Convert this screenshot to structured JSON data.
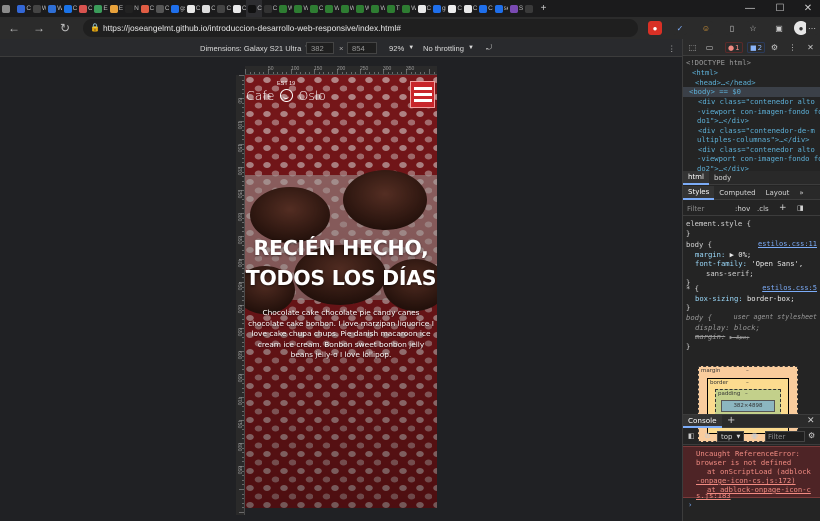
{
  "browser": {
    "tabs": [
      {
        "icon": "sidebar-icon",
        "label": "",
        "color": "#8a8a8a"
      },
      {
        "icon": "tab-favicon",
        "label": "Ca",
        "color": "#3367d6"
      },
      {
        "icon": "tab-favicon",
        "label": "W",
        "color": "#444"
      },
      {
        "icon": "tab-favicon",
        "label": "W",
        "color": "#2f6fd6"
      },
      {
        "icon": "tab-favicon",
        "label": "Ca",
        "color": "#1a73e8"
      },
      {
        "icon": "tab-favicon",
        "label": "Cs",
        "color": "#d9534f"
      },
      {
        "icon": "tab-favicon",
        "label": "Es",
        "color": "#3b9c5a"
      },
      {
        "icon": "tab-favicon",
        "label": "Es",
        "color": "#e9a23b"
      },
      {
        "icon": "tab-favicon",
        "label": "N",
        "color": "#222"
      },
      {
        "icon": "tab-favicon",
        "label": "Ce",
        "color": "#e05d44"
      },
      {
        "icon": "tab-favicon",
        "label": "Cs",
        "color": "#555"
      },
      {
        "icon": "tab-favicon",
        "label": "gs",
        "color": "#1f6feb"
      },
      {
        "icon": "tab-favicon",
        "label": "Ci",
        "color": "#e9e9e9"
      },
      {
        "icon": "tab-favicon",
        "label": "Ce",
        "color": "#ddd"
      },
      {
        "icon": "tab-favicon",
        "label": "Cs",
        "color": "#444"
      },
      {
        "icon": "tab-favicon",
        "label": "Cs",
        "color": "#e9e9e9"
      },
      {
        "icon": "tab-favicon",
        "label": "CS",
        "color": "#111"
      },
      {
        "icon": "tab-favicon",
        "label": "Cs",
        "color": "#333"
      },
      {
        "icon": "tab-favicon",
        "label": "W",
        "color": "#2e7d32"
      },
      {
        "icon": "tab-favicon",
        "label": "W",
        "color": "#2e7d32"
      },
      {
        "icon": "tab-favicon",
        "label": "Ce",
        "color": "#2e7d32"
      },
      {
        "icon": "tab-favicon",
        "label": "W",
        "color": "#2e7d32"
      },
      {
        "icon": "tab-favicon",
        "label": "W",
        "color": "#2e7d32"
      },
      {
        "icon": "tab-favicon",
        "label": "W",
        "color": "#2e7d32"
      },
      {
        "icon": "tab-favicon",
        "label": "W",
        "color": "#2e7d32"
      },
      {
        "icon": "tab-favicon",
        "label": "Tr",
        "color": "#2e7d32"
      },
      {
        "icon": "tab-favicon",
        "label": "W",
        "color": "#2e7d32"
      },
      {
        "icon": "tab-favicon",
        "label": "Cs",
        "color": "#e9e9e9"
      },
      {
        "icon": "tab-favicon",
        "label": "gi",
        "color": "#1f6feb"
      },
      {
        "icon": "tab-favicon",
        "label": "Cr",
        "color": "#eee"
      },
      {
        "icon": "tab-favicon",
        "label": "Ce",
        "color": "#e9e9e9"
      },
      {
        "icon": "tab-favicon",
        "label": "Ce",
        "color": "#1f6feb"
      },
      {
        "icon": "tab-favicon",
        "label": "se",
        "color": "#1f6feb"
      },
      {
        "icon": "tab-favicon",
        "label": "Sc",
        "color": "#7a4ab3"
      },
      {
        "icon": "tab-favicon",
        "label": "",
        "color": "#3a3a3a"
      }
    ],
    "new_tab": "+",
    "window_controls": {
      "minimize": "—",
      "maximize": "☐",
      "close": "✕"
    },
    "url": "https://joseangelmt.github.io/introduccion-desarrollo-web-responsive/index.html#"
  },
  "device_toolbar": {
    "dimensions_label": "Dimensions: Galaxy S21 Ultra",
    "width": "382",
    "times": "×",
    "height": "854",
    "zoom": "92%",
    "throttling": "No throttling"
  },
  "ruler": {
    "top_marks": [
      "50",
      "100",
      "150",
      "200",
      "250",
      "300",
      "350"
    ],
    "left_marks": [
      "50",
      "100",
      "150",
      "200",
      "250",
      "300",
      "350",
      "400",
      "450",
      "500",
      "550",
      "600",
      "650",
      "700",
      "750",
      "800",
      "850"
    ]
  },
  "page": {
    "logo_left": "Cafe",
    "logo_right": "Oslo",
    "logo_est": "EST 19",
    "hero_title_line1": "RECIÉN HECHO,",
    "hero_title_line2": "TODOS LOS DÍAS",
    "hero_text": "Chocolate cake chocolate pie candy canes chocolate cake bonbon. I love marzipan liquorice I love cake chupa chups. Pie danish macaroon ice cream ice cream. Bonbon sweet bonbon jelly beans jelly-o I love lollipop.",
    "accent_color": "#c8262b"
  },
  "devtools": {
    "errors": "1",
    "issues": "2",
    "dom": [
      "<!DOCTYPE html>",
      "<html>",
      "<head>…</head>",
      "<body> == $0",
      "<div class=\"contenedor alto",
      "-viewport con-imagen-fondo fon",
      "do1\">…</div>",
      "<div class=\"contenedor-de-m",
      "ultiples-columnas\">…</div>",
      "<div class=\"contenedor alto",
      "-viewport con-imagen-fondo fon",
      "do2\">…</div>",
      "<div class=\"contenedor-de-m"
    ],
    "breadcrumb": [
      "html",
      "body"
    ],
    "panel_tabs": [
      "Styles",
      "Computed",
      "Layout",
      "»"
    ],
    "filter_placeholder": "Filter",
    "hov": ":hov",
    "cls": ".cls",
    "styles": {
      "element_style": "element.style {",
      "close_brace": "}",
      "rule1_selector": "body {",
      "rule1_source": "estilos.css:11",
      "rule1_margin_prop": "margin:",
      "rule1_margin_val": "▶ 0%;",
      "rule1_font_prop": "font-family:",
      "rule1_font_val": "'Open Sans',",
      "rule1_font_val2": "sans-serif;",
      "rule2_selector": "* {",
      "rule2_source": "estilos.css:5",
      "rule2_prop": "box-sizing:",
      "rule2_val": "border-box;",
      "rule3_selector": "body {",
      "rule3_source": "user agent stylesheet",
      "rule3_display_prop": "display:",
      "rule3_display_val": "block;",
      "rule3_margin_prop": "margin:",
      "rule3_margin_val": "▶ 8px;"
    },
    "boxmodel": {
      "margin": "margin",
      "border": "border",
      "padding": "padding",
      "dash": "–",
      "content": "382×4898"
    },
    "console": {
      "title": "Console",
      "context": "top",
      "filter_placeholder": "Filter",
      "error_line1": "Uncaught ReferenceError:",
      "error_line2": "browser is not defined",
      "error_line3": "at onScriptLoad (adblock",
      "error_line4": "-onpage-icon-cs.js:172)",
      "error_line5": "at adblock-onpage-icon-c",
      "error_line6": "s.js:183",
      "prompt": "›"
    }
  }
}
